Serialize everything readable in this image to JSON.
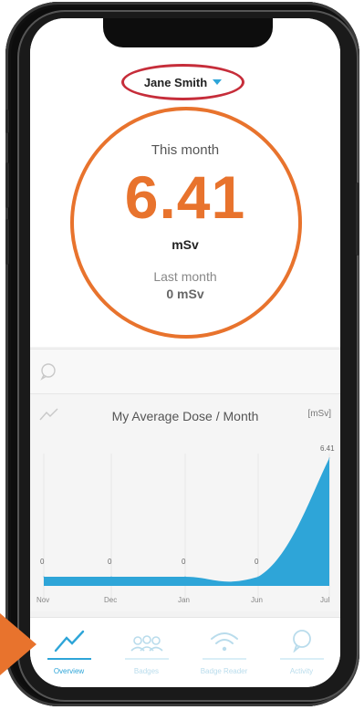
{
  "header": {
    "user_name": "Jane Smith"
  },
  "dose": {
    "current_label": "This month",
    "current_value": "6.41",
    "unit": "mSv",
    "previous_label": "Last month",
    "previous_value": "0 mSv"
  },
  "chart_card": {
    "title": "My Average Dose / Month",
    "unit_label": "[mSv]"
  },
  "chart_data": {
    "type": "area",
    "title": "My Average Dose / Month",
    "ylabel": "[mSv]",
    "x": [
      "Nov",
      "Dec",
      "Jan",
      "Jun",
      "Jul"
    ],
    "values": [
      0,
      0,
      0,
      0,
      6.41
    ],
    "data_labels": [
      "0",
      "0",
      "0",
      "0",
      "6.41"
    ],
    "color": "#2ea5d8"
  },
  "nav": {
    "items": [
      {
        "label": "Overview",
        "icon": "trend-line-icon",
        "active": true
      },
      {
        "label": "Badges",
        "icon": "people-group-icon",
        "active": false
      },
      {
        "label": "Badge Reader",
        "icon": "wifi-signal-icon",
        "active": false
      },
      {
        "label": "Activity",
        "icon": "speech-bubble-icon",
        "active": false
      }
    ]
  },
  "colors": {
    "accent": "#e8732d",
    "chart": "#2ea5d8",
    "highlight_ring": "#c62d3a"
  }
}
